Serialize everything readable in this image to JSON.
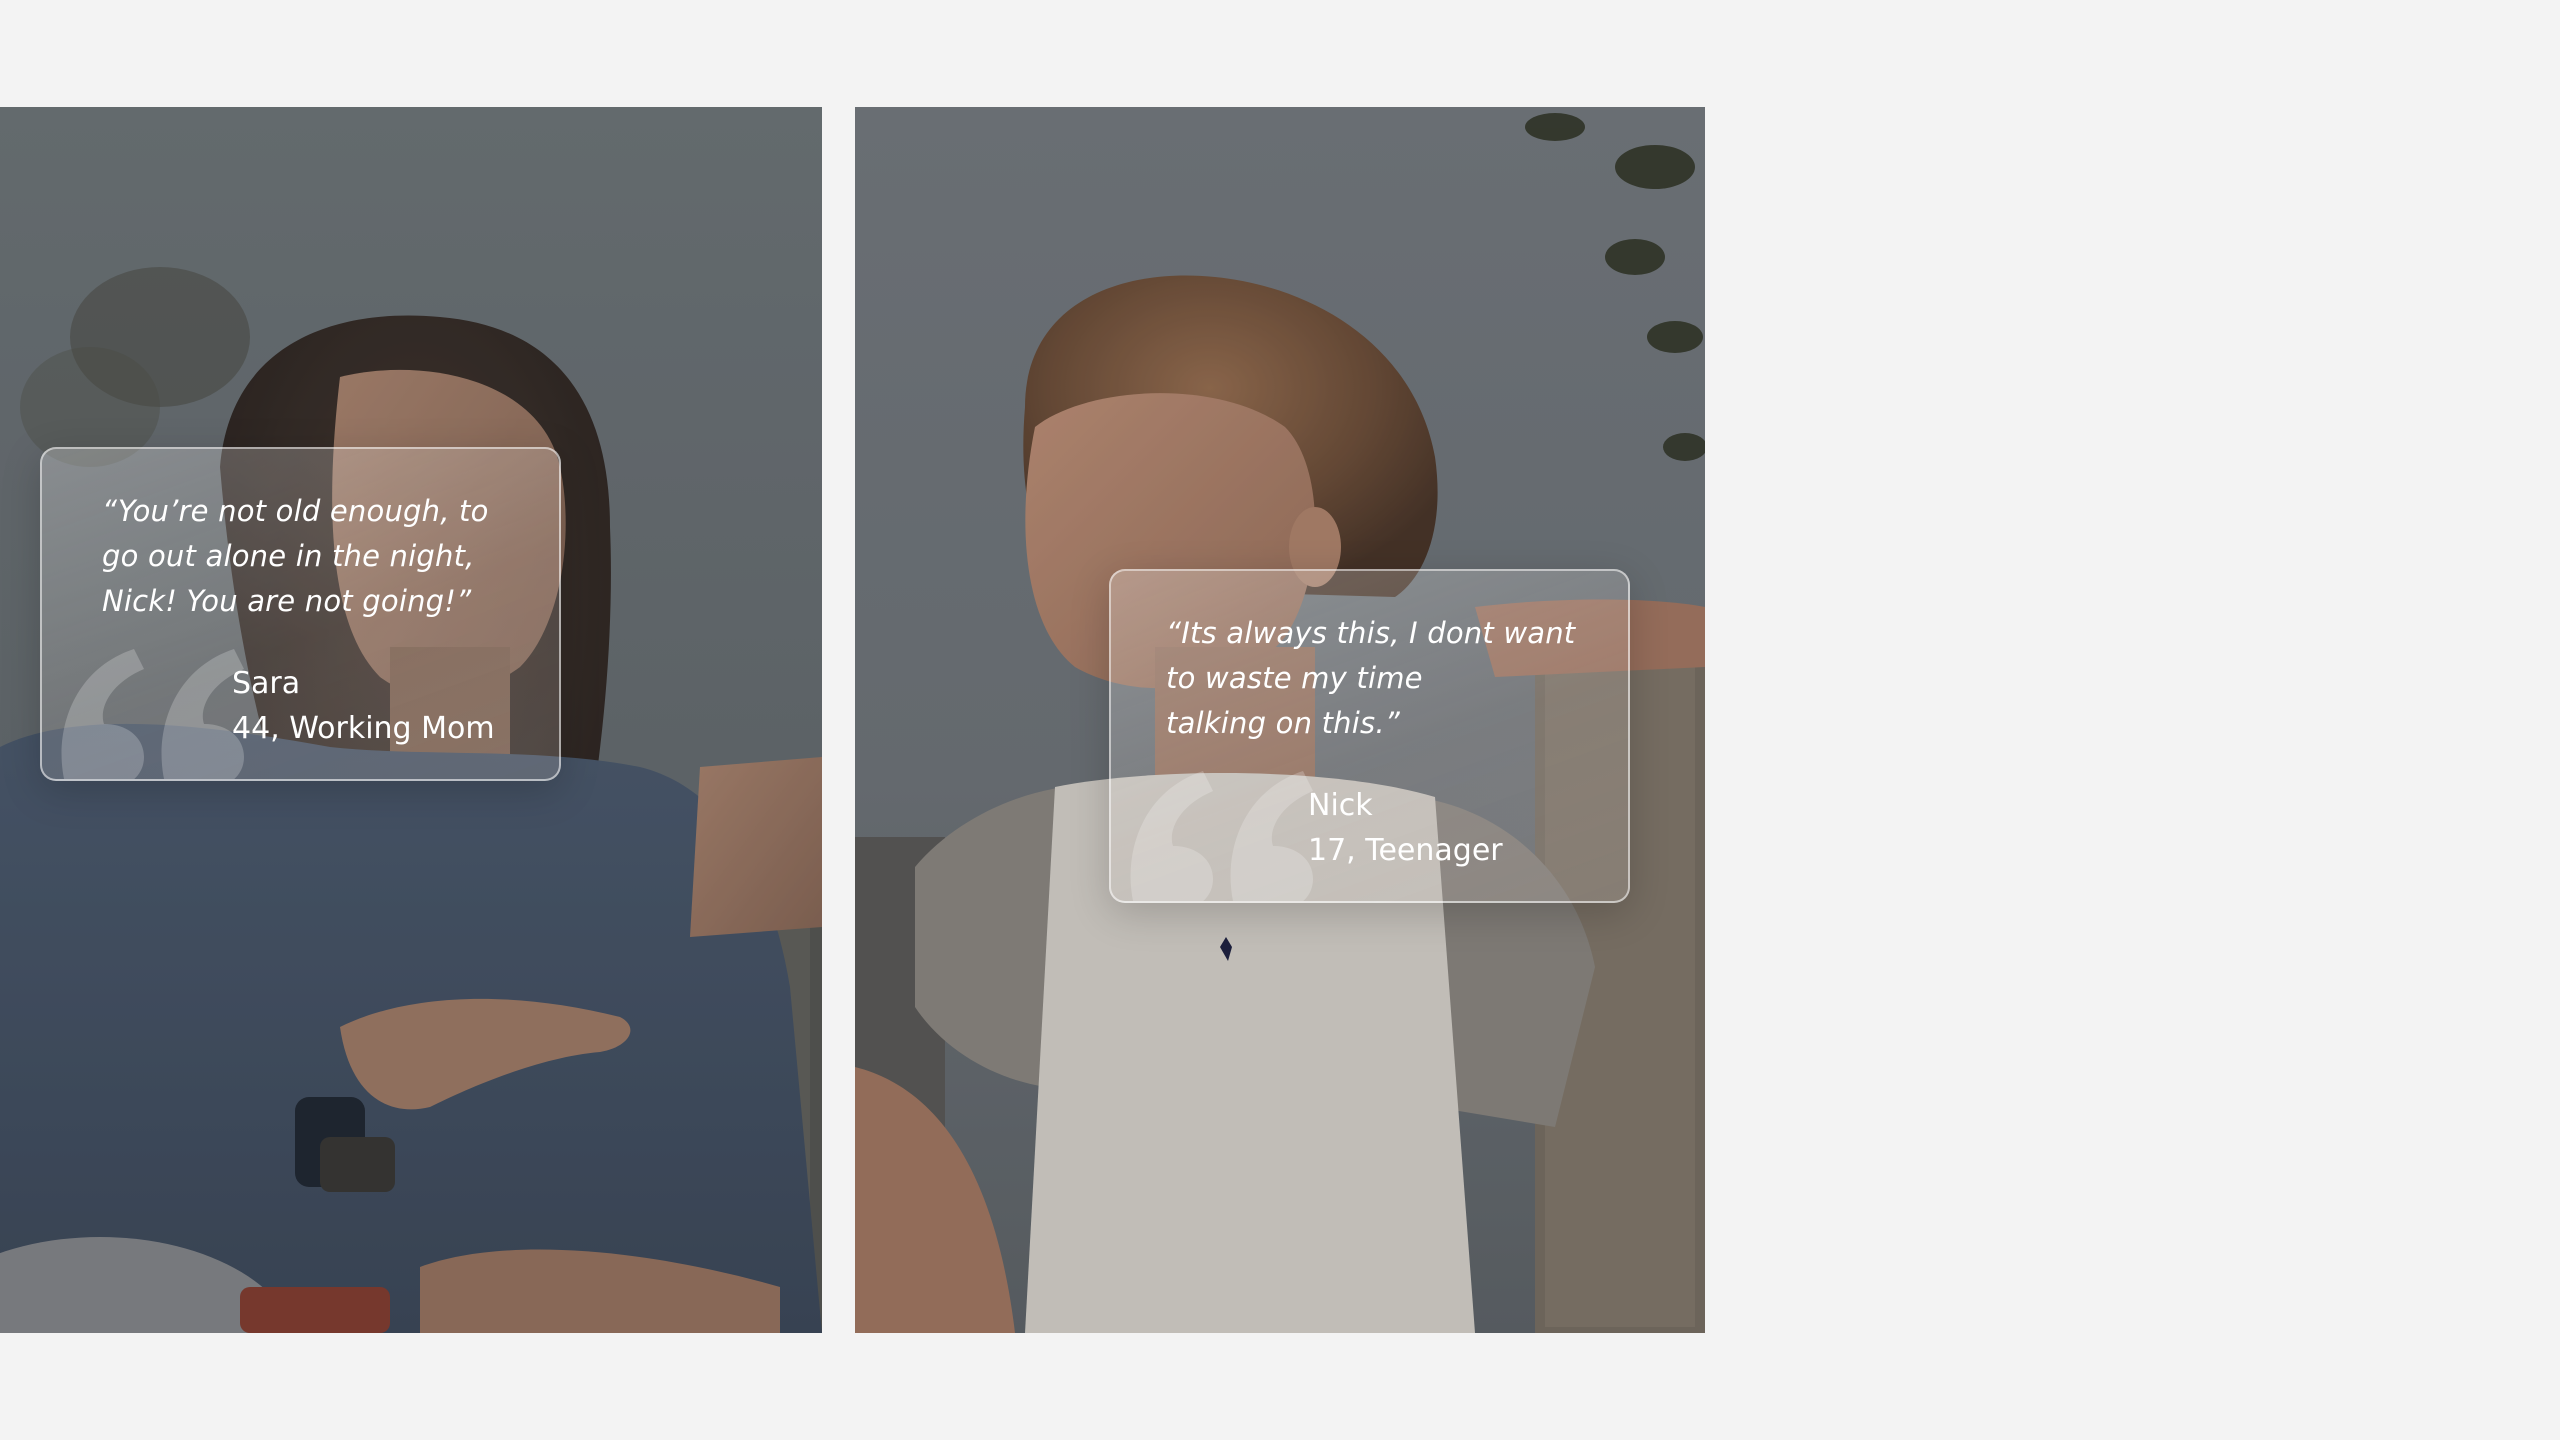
{
  "testimonials": [
    {
      "quote_lines": [
        "“You’re not old enough, to",
        "go out alone in the night,",
        "Nick! You are not going!”"
      ],
      "name": "Sara",
      "role": "44, Working Mom"
    },
    {
      "quote_lines": [
        "“Its always this, I dont want",
        "to waste my time",
        "talking on this.”"
      ],
      "name": "Nick",
      "role": "17, Teenager"
    }
  ],
  "colors": {
    "background": "#f3f3f3",
    "card_text": "#ffffff"
  },
  "icons": [
    "quote-icon"
  ]
}
